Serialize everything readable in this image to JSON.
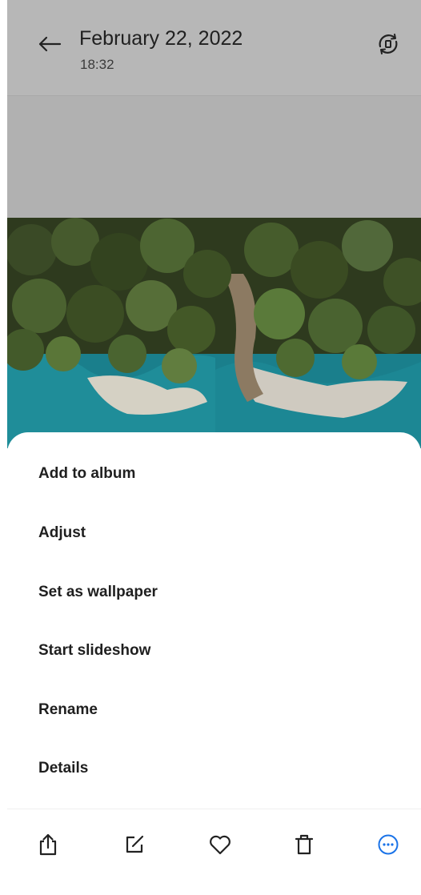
{
  "header": {
    "title": "February 22, 2022",
    "time": "18:32",
    "back_icon": "arrow-left-icon",
    "rotate_icon": "rotate-icon"
  },
  "menu": {
    "items": [
      {
        "label": "Add to album"
      },
      {
        "label": "Adjust"
      },
      {
        "label": "Set as wallpaper"
      },
      {
        "label": "Start slideshow"
      },
      {
        "label": "Rename"
      },
      {
        "label": "Details"
      }
    ]
  },
  "toolbar": {
    "icons": [
      "share-icon",
      "edit-icon",
      "favorite-icon",
      "delete-icon",
      "more-icon"
    ],
    "active_color": "#1a73e8"
  }
}
